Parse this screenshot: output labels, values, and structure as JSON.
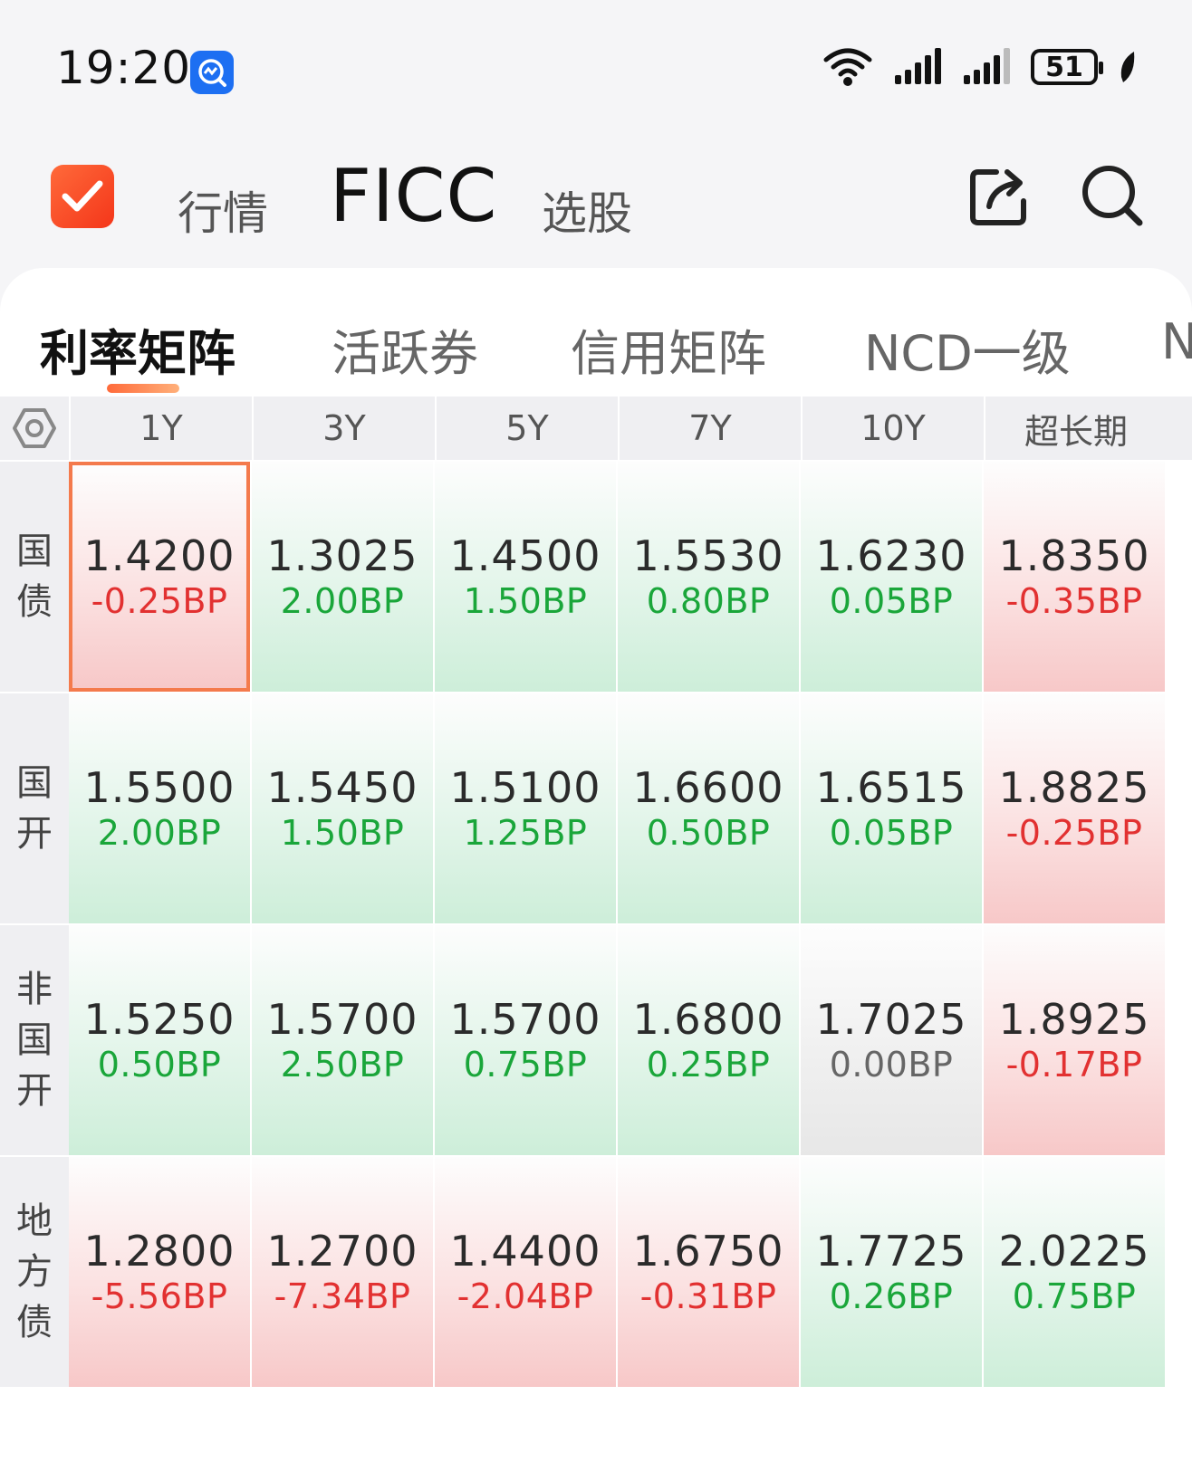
{
  "status_bar": {
    "time": "19:20",
    "battery": "51",
    "icons": [
      "wifi-icon",
      "signal-icon",
      "signal-icon",
      "battery-icon",
      "leaf-icon"
    ]
  },
  "header": {
    "nav": [
      "行情",
      "FICC",
      "选股"
    ],
    "active_nav": "FICC",
    "icons": [
      "share-icon",
      "search-icon"
    ],
    "accent": "#f4501f"
  },
  "subtabs": {
    "items": [
      "利率矩阵",
      "活跃券",
      "信用矩阵",
      "NCD一级",
      "N"
    ],
    "active_index": 0
  },
  "matrix": {
    "columns": [
      "1Y",
      "3Y",
      "5Y",
      "7Y",
      "10Y",
      "超长期"
    ],
    "rows": [
      {
        "label": [
          "国",
          "债"
        ],
        "cells": [
          {
            "yield": "1.4200",
            "change": "-0.25BP",
            "dir": "up",
            "selected": true
          },
          {
            "yield": "1.3025",
            "change": "2.00BP",
            "dir": "down"
          },
          {
            "yield": "1.4500",
            "change": "1.50BP",
            "dir": "down"
          },
          {
            "yield": "1.5530",
            "change": "0.80BP",
            "dir": "down"
          },
          {
            "yield": "1.6230",
            "change": "0.05BP",
            "dir": "down"
          },
          {
            "yield": "1.8350",
            "change": "-0.35BP",
            "dir": "up"
          }
        ]
      },
      {
        "label": [
          "国",
          "开"
        ],
        "cells": [
          {
            "yield": "1.5500",
            "change": "2.00BP",
            "dir": "down"
          },
          {
            "yield": "1.5450",
            "change": "1.50BP",
            "dir": "down"
          },
          {
            "yield": "1.5100",
            "change": "1.25BP",
            "dir": "down"
          },
          {
            "yield": "1.6600",
            "change": "0.50BP",
            "dir": "down"
          },
          {
            "yield": "1.6515",
            "change": "0.05BP",
            "dir": "down"
          },
          {
            "yield": "1.8825",
            "change": "-0.25BP",
            "dir": "up"
          }
        ]
      },
      {
        "label": [
          "非",
          "国",
          "开"
        ],
        "cells": [
          {
            "yield": "1.5250",
            "change": "0.50BP",
            "dir": "down"
          },
          {
            "yield": "1.5700",
            "change": "2.50BP",
            "dir": "down"
          },
          {
            "yield": "1.5700",
            "change": "0.75BP",
            "dir": "down"
          },
          {
            "yield": "1.6800",
            "change": "0.25BP",
            "dir": "down"
          },
          {
            "yield": "1.7025",
            "change": "0.00BP",
            "dir": "flat"
          },
          {
            "yield": "1.8925",
            "change": "-0.17BP",
            "dir": "up"
          }
        ]
      },
      {
        "label": [
          "地",
          "方",
          "债"
        ],
        "cells": [
          {
            "yield": "1.2800",
            "change": "-5.56BP",
            "dir": "up"
          },
          {
            "yield": "1.2700",
            "change": "-7.34BP",
            "dir": "up"
          },
          {
            "yield": "1.4400",
            "change": "-2.04BP",
            "dir": "up"
          },
          {
            "yield": "1.6750",
            "change": "-0.31BP",
            "dir": "up"
          },
          {
            "yield": "1.7725",
            "change": "0.26BP",
            "dir": "down"
          },
          {
            "yield": "2.0225",
            "change": "0.75BP",
            "dir": "down"
          }
        ]
      }
    ],
    "colors": {
      "up_text": "#e23131",
      "down_text": "#1aa63a",
      "flat_text": "#666666"
    }
  }
}
